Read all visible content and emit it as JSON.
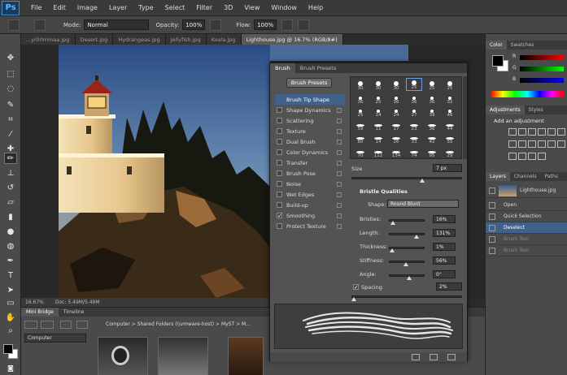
{
  "app": {
    "logo": "Ps"
  },
  "menu": [
    "File",
    "Edit",
    "Image",
    "Layer",
    "Type",
    "Select",
    "Filter",
    "3D",
    "View",
    "Window",
    "Help"
  ],
  "options_bar": {
    "mode_label": "Mode:",
    "mode_value": "Normal",
    "opacity_label": "Opacity:",
    "opacity_value": "100%",
    "flow_label": "Flow:",
    "flow_value": "100%"
  },
  "doc_tabs": [
    {
      "label": "...yrllrlmmaa.jpg",
      "active": false
    },
    {
      "label": "Desert.jpg",
      "active": false
    },
    {
      "label": "Hydrangeas.jpg",
      "active": false
    },
    {
      "label": "Jellyfish.jpg",
      "active": false
    },
    {
      "label": "Koala.jpg",
      "active": false
    },
    {
      "label": "Lighthouse.jpg @ 16.7% (RGB/8#)",
      "active": true
    }
  ],
  "doc_status": {
    "zoom": "16.67%",
    "doc_info": "Doc: 5.49M/5.49M"
  },
  "mini_bridge": {
    "tabs": [
      "Mini Bridge",
      "Timeline"
    ],
    "path": "Computer > Shared Folders (\\\\vmware-host) > MyST > M...",
    "location": "Computer"
  },
  "brush_panel": {
    "tabs": [
      "Brush",
      "Brush Presets"
    ],
    "presets_button": "Brush Presets",
    "options": [
      {
        "label": "Brush Tip Shape",
        "checked": false,
        "selected": true
      },
      {
        "label": "Shape Dynamics",
        "checked": false,
        "selected": false
      },
      {
        "label": "Scattering",
        "checked": false,
        "selected": false
      },
      {
        "label": "Texture",
        "checked": false,
        "selected": false
      },
      {
        "label": "Dual Brush",
        "checked": false,
        "selected": false
      },
      {
        "label": "Color Dynamics",
        "checked": false,
        "selected": false
      },
      {
        "label": "Transfer",
        "checked": false,
        "selected": false
      },
      {
        "label": "Brush Pose",
        "checked": false,
        "selected": false
      },
      {
        "label": "Noise",
        "checked": false,
        "selected": false
      },
      {
        "label": "Wet Edges",
        "checked": false,
        "selected": false
      },
      {
        "label": "Build-up",
        "checked": false,
        "selected": false
      },
      {
        "label": "Smoothing",
        "checked": true,
        "selected": false
      },
      {
        "label": "Protect Texture",
        "checked": false,
        "selected": false
      }
    ],
    "tip_sizes": [
      [
        "30",
        "30",
        "30",
        "25",
        "25",
        "25"
      ],
      [
        "36",
        "25",
        "36",
        "36",
        "36",
        "32"
      ],
      [
        "25",
        "14",
        "24",
        "27",
        "39",
        "46"
      ],
      [
        "59",
        "11",
        "17",
        "23",
        "36",
        "44"
      ],
      [
        "60",
        "14",
        "26",
        "33",
        "42",
        "55"
      ],
      [
        "70",
        "112",
        "134",
        "74",
        "95",
        "29"
      ]
    ],
    "size_label": "Size",
    "size_value": "7 px",
    "bristle_heading": "Bristle Qualities",
    "shape_label": "Shape:",
    "shape_value": "Round Blunt",
    "params": [
      {
        "label": "Bristles:",
        "value": "16%"
      },
      {
        "label": "Length:",
        "value": "131%"
      },
      {
        "label": "Thickness:",
        "value": "1%"
      },
      {
        "label": "Stiffness:",
        "value": "56%"
      },
      {
        "label": "Angle:",
        "value": "0°"
      }
    ],
    "spacing_label": "Spacing",
    "spacing_value": "2%",
    "colors": {
      "selected": "#40628a",
      "panel": "#535353"
    }
  },
  "right_dock": {
    "color_tabs": [
      "Color",
      "Swatches"
    ],
    "color_letters": [
      "R",
      "G",
      "B"
    ],
    "adj_tabs": [
      "Adjustments",
      "Styles"
    ],
    "adj_heading": "Add an adjustment",
    "layers_tabs": [
      "Layers",
      "Channels",
      "Paths"
    ],
    "layer_name": "Lighthouse.jpg",
    "history": [
      {
        "label": "Open",
        "state": "normal"
      },
      {
        "label": "Quick Selection",
        "state": "normal"
      },
      {
        "label": "Deselect",
        "state": "active"
      },
      {
        "label": "Brush Tool",
        "state": "dim"
      },
      {
        "label": "Brush Tool",
        "state": "dim"
      }
    ]
  }
}
